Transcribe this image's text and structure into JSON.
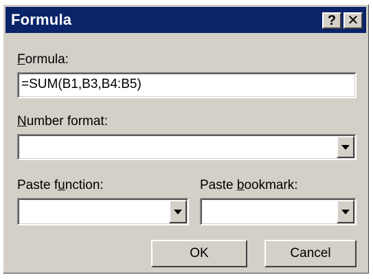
{
  "window": {
    "title": "Formula",
    "help_label": "?",
    "close_label": "✕"
  },
  "formula": {
    "label_accel": "F",
    "label_rest": "ormula:",
    "value": "=SUM(B1,B3,B4:B5)"
  },
  "number_format": {
    "label_accel": "N",
    "label_rest": "umber format:",
    "value": ""
  },
  "paste_function": {
    "label_pre": "Paste f",
    "label_accel": "u",
    "label_rest": "nction:",
    "value": ""
  },
  "paste_bookmark": {
    "label_pre": "Paste ",
    "label_accel": "b",
    "label_rest": "ookmark:",
    "value": ""
  },
  "buttons": {
    "ok": "OK",
    "cancel": "Cancel"
  },
  "colors": {
    "titlebar": "#0a246a",
    "face": "#d4d0c8"
  },
  "icons": {
    "help": "question-mark-icon",
    "close": "close-icon",
    "dropdown": "chevron-down-icon"
  }
}
